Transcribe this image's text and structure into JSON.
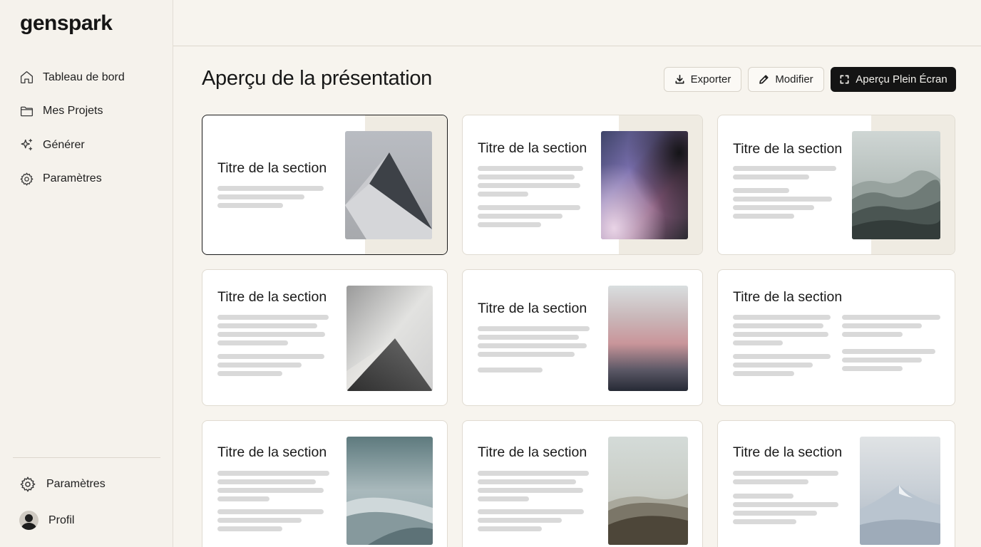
{
  "app": {
    "logo": "genspark"
  },
  "sidebar": {
    "items": [
      {
        "label": "Tableau de bord",
        "icon": "home-icon"
      },
      {
        "label": "Mes Projets",
        "icon": "folder-icon"
      },
      {
        "label": "Générer",
        "icon": "sparkle-icon"
      },
      {
        "label": "Paramètres",
        "icon": "gear-icon"
      }
    ],
    "bottom": {
      "settings_label": "Paramètres",
      "profile_label": "Profil"
    }
  },
  "header": {
    "title": "Aperçu de la présentation",
    "export_label": "Exporter",
    "edit_label": "Modifier",
    "fullscreen_label": "Aperçu Plein Écran"
  },
  "slides": [
    {
      "title": "Titre de la section",
      "image": "pyramid-image",
      "selected": true
    },
    {
      "title": "Titre de la section",
      "image": "purple-gradient-image"
    },
    {
      "title": "Titre de la section",
      "image": "misty-mountains-image"
    },
    {
      "title": "Titre de la section",
      "image": "shadow-cone-image"
    },
    {
      "title": "Titre de la section",
      "image": "sunset-gradient-image"
    },
    {
      "title": "Titre de la section",
      "image": "none"
    },
    {
      "title": "Titre de la section",
      "image": "teal-dunes-image"
    },
    {
      "title": "Titre de la section",
      "image": "desert-hills-image"
    },
    {
      "title": "Titre de la section",
      "image": "snowy-peak-image"
    }
  ],
  "colors": {
    "background": "#f7f4ee",
    "primary_button": "#141414",
    "placeholder_bar": "#d9d9d9"
  }
}
